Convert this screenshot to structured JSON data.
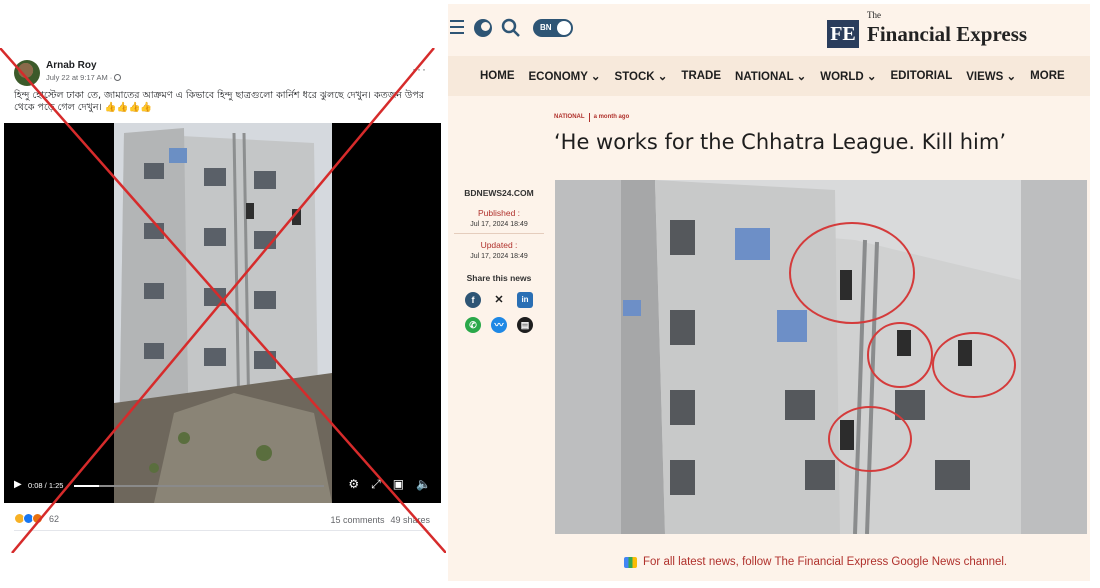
{
  "facebook_post": {
    "author": "Arnab Roy",
    "timestamp": "July 22 at 9:17 AM · ",
    "more": "···",
    "text": "হিন্দু হোস্টেল ঢাকা তে, জামাতের আক্রমণ এ কিভাবে হিন্দু ছাত্রগুলো কার্নিশ ধরে ঝুলছে দেখুন। কতজন উপর থেকে পড়ে গেল দেখুন। 👍👍👍👍",
    "video": {
      "timecode": "0:08 / 1:25",
      "progress": 0.1,
      "controls": [
        "settings-icon",
        "expand-icon",
        "pip-icon",
        "mute-icon"
      ]
    },
    "reactions_count": "62",
    "comments": "15 comments",
    "shares": "49 shares",
    "crossed_out_color": "#d62b2b"
  },
  "fe": {
    "logo_abbr": "FE",
    "logo_the": "The",
    "logo_name": "Financial Express",
    "lang_toggle": "BN",
    "nav": [
      "HOME",
      "ECONOMY ⌄",
      "STOCK ⌄",
      "TRADE",
      "NATIONAL ⌄",
      "WORLD ⌄",
      "EDITORIAL",
      "VIEWS ⌄",
      "MORE"
    ],
    "category": "NATIONAL",
    "category_time": "a month ago",
    "headline": "‘He works for the Chhatra League. Kill him’",
    "source": "BDNEWS24.COM",
    "published_label": "Published :",
    "published_date": "Jul 17, 2024 18:49",
    "updated_label": "Updated :",
    "updated_date": "Jul 17, 2024 18:49",
    "share_label": "Share this news",
    "share_icons": [
      "facebook-icon",
      "x-icon",
      "linkedin-icon",
      "whatsapp-icon",
      "messenger-icon",
      "print-icon"
    ],
    "footer_note": "For all latest news, follow The Financial Express Google News channel.",
    "accent": "#b0312c",
    "nav_bg": "#f7e9db",
    "page_bg": "#fdf3ea"
  }
}
